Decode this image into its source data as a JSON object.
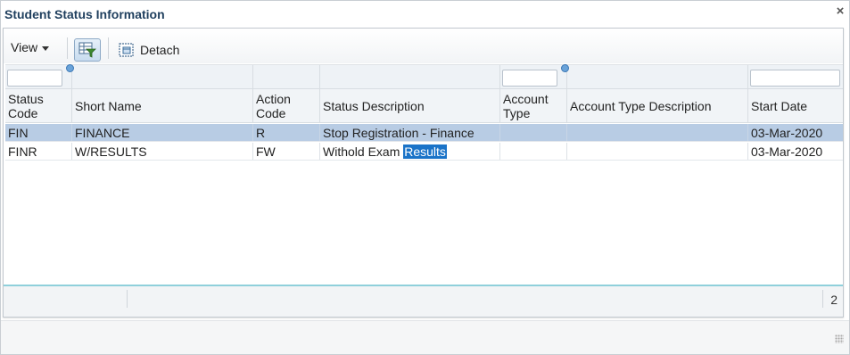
{
  "dialog": {
    "title": "Student Status Information",
    "close_glyph": "×"
  },
  "toolbar": {
    "view_label": "View",
    "detach_label": "Detach",
    "icons": [
      "filter-icon",
      "detach-icon"
    ]
  },
  "table": {
    "columns": [
      {
        "label": "Status Code"
      },
      {
        "label": "Short Name"
      },
      {
        "label": "Action Code"
      },
      {
        "label": "Status Description"
      },
      {
        "label": "Account Type"
      },
      {
        "label": "Account Type Description"
      },
      {
        "label": "Start Date"
      }
    ],
    "rows": [
      {
        "status_code": "FIN",
        "short_name": "FINANCE",
        "action_code": "R",
        "status_description": "Stop Registration - Finance",
        "account_type": "",
        "account_type_description": "",
        "start_date": "03-Mar-2020",
        "selected": true
      },
      {
        "status_code": "FINR",
        "short_name": "W/RESULTS",
        "action_code": "FW",
        "status_description_prefix": "Withold Exam ",
        "status_description_highlight": "Results",
        "account_type": "",
        "account_type_description": "",
        "start_date": "03-Mar-2020",
        "selected": false
      }
    ]
  },
  "footer": {
    "record_count": "2"
  },
  "colors": {
    "title": "#1f3f5e",
    "selected_row": "#b8cce4",
    "highlight": "#1a73c8",
    "footer_accent": "#8fd0db"
  }
}
